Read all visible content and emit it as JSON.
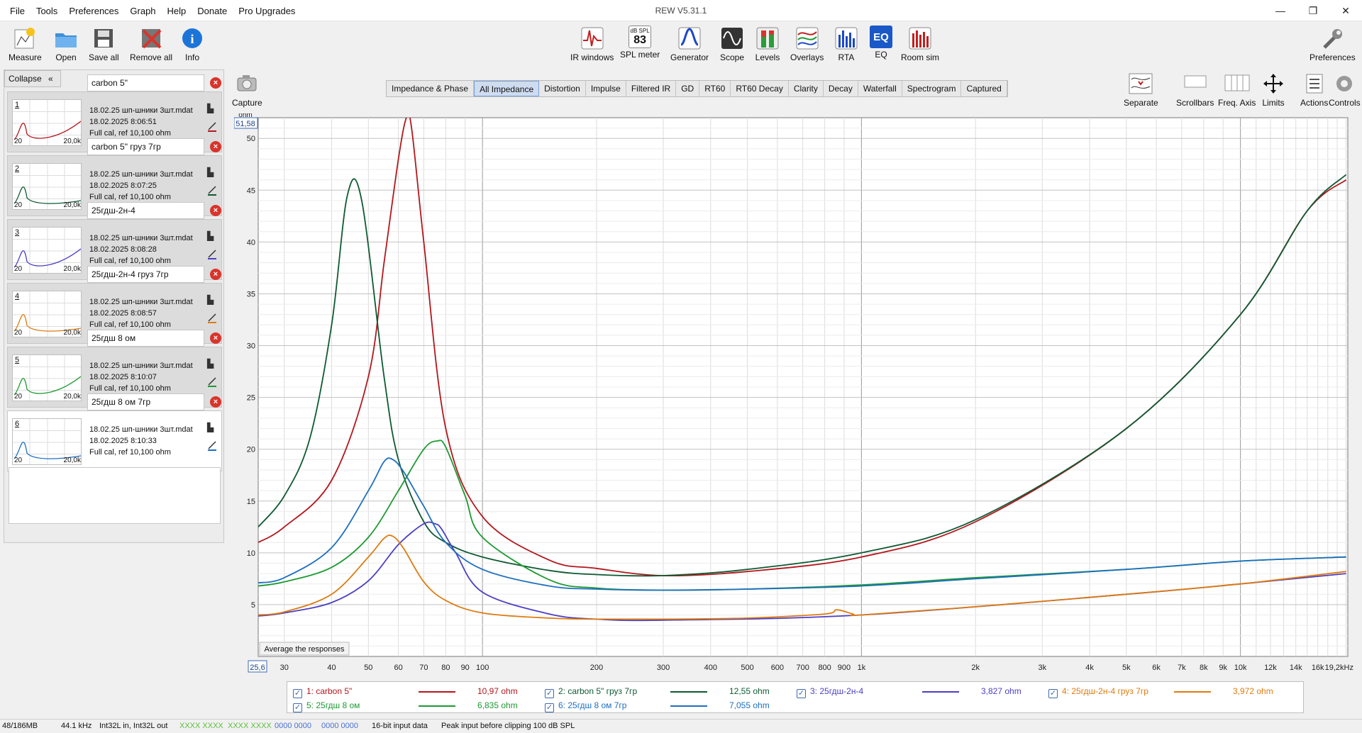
{
  "app": {
    "title": "REW V5.31.1",
    "menus": [
      "File",
      "Tools",
      "Preferences",
      "Graph",
      "Help",
      "Donate",
      "Pro Upgrades"
    ],
    "window_controls": [
      "—",
      "❐",
      "✕"
    ]
  },
  "toolbar": {
    "measure": "Measure",
    "open": "Open",
    "save_all": "Save all",
    "remove_all": "Remove all",
    "info": "Info",
    "ir_windows": "IR windows",
    "spl_meter": "SPL meter",
    "spl_badge": "dB SPL",
    "spl_value": "83",
    "generator": "Generator",
    "scope": "Scope",
    "levels": "Levels",
    "overlays": "Overlays",
    "rta": "RTA",
    "eq": "EQ",
    "eq_badge": "EQ",
    "room_sim": "Room sim",
    "preferences": "Preferences",
    "capture": "Capture",
    "separate": "Separate",
    "scrollbars": "Scrollbars",
    "freq_axis": "Freq. Axis",
    "limits": "Limits",
    "actions": "Actions",
    "controls": "Controls"
  },
  "panel": {
    "collapse": "Collapse",
    "collapse_icon": "«",
    "entries": [
      {
        "num": "1",
        "name": "carbon 5\"",
        "file": "18.02.25 шп-шники 3шт.mdat",
        "date": "18.02.2025 8:06:51",
        "cal": "Full cal, ref 10,100 ohm",
        "color": "#b3171d"
      },
      {
        "num": "2",
        "name": "carbon 5\" груз 7гр",
        "file": "18.02.25 шп-шники 3шт.mdat",
        "date": "18.02.2025 8:07:25",
        "cal": "Full cal, ref 10,100 ohm",
        "color": "#0e5a33"
      },
      {
        "num": "3",
        "name": "25гдш-2н-4",
        "file": "18.02.25 шп-шники 3шт.mdat",
        "date": "18.02.2025 8:08:28",
        "cal": "Full cal, ref 10,100 ohm",
        "color": "#4b3fc4"
      },
      {
        "num": "4",
        "name": "25гдш-2н-4 груз 7гр",
        "file": "18.02.25 шп-шники 3шт.mdat",
        "date": "18.02.2025 8:08:57",
        "cal": "Full cal, ref 10,100 ohm",
        "color": "#de7b10"
      },
      {
        "num": "5",
        "name": "25гдш 8 ом",
        "file": "18.02.25 шп-шники 3шт.mdat",
        "date": "18.02.2025 8:10:07",
        "cal": "Full cal, ref 10,100 ohm",
        "color": "#1d9a32"
      },
      {
        "num": "6",
        "name": "25гдш 8 ом 7гр",
        "file": "18.02.25 шп-шники 3шт.mdat",
        "date": "18.02.2025 8:10:33",
        "cal": "Full cal, ref 10,100 ohm",
        "color": "#1d6fc0"
      }
    ],
    "thumb_lo": "20",
    "thumb_hi": "20,0k"
  },
  "tabs": [
    "Impedance & Phase",
    "All Impedance",
    "Distortion",
    "Impulse",
    "Filtered IR",
    "GD",
    "RT60",
    "RT60 Decay",
    "Clarity",
    "Decay",
    "Waterfall",
    "Spectrogram",
    "Captured"
  ],
  "active_tab": "All Impedance",
  "graph": {
    "average_button": "Average the responses",
    "cursor_y": "51,58",
    "unit_label": "ohm",
    "cursor_x": "25,6"
  },
  "chart_data": {
    "type": "line",
    "title": "",
    "xlabel": "",
    "ylabel": "ohm",
    "x_scale": "log",
    "xlim": [
      25.6,
      19200
    ],
    "ylim": [
      0,
      52
    ],
    "grid": true,
    "x_tick_labels": [
      "30",
      "40",
      "50",
      "60",
      "70",
      "80",
      "90",
      "100",
      "200",
      "300",
      "400",
      "500",
      "600",
      "700",
      "800",
      "900",
      "1k",
      "2k",
      "3k",
      "4k",
      "5k",
      "6k",
      "7k",
      "8k",
      "9k",
      "10k",
      "12k",
      "14k",
      "16k",
      "19,2kHz"
    ],
    "x_tick_values": [
      30,
      40,
      50,
      60,
      70,
      80,
      90,
      100,
      200,
      300,
      400,
      500,
      600,
      700,
      800,
      900,
      1000,
      2000,
      3000,
      4000,
      5000,
      6000,
      7000,
      8000,
      9000,
      10000,
      12000,
      14000,
      16000,
      19200
    ],
    "y_tick_values": [
      5,
      10,
      15,
      20,
      25,
      30,
      35,
      40,
      45,
      50
    ],
    "y_tick_labels": [
      "5",
      "10",
      "15",
      "20",
      "25",
      "30",
      "35",
      "40",
      "45",
      "50"
    ],
    "series": [
      {
        "name": "1: carbon 5\"",
        "color": "#b3171d",
        "value_label": "10,97 ohm",
        "x": [
          25.6,
          30,
          40,
          50,
          55,
          60,
          63,
          65,
          70,
          80,
          100,
          150,
          200,
          300,
          500,
          1000,
          2000,
          5000,
          10000,
          15000,
          19000
        ],
        "y": [
          11,
          12.5,
          17,
          27,
          38,
          48,
          52,
          51,
          40,
          22,
          13.5,
          9.3,
          8.5,
          7.8,
          8.2,
          9.6,
          13,
          22,
          33,
          43,
          46
        ]
      },
      {
        "name": "2: carbon 5\" груз 7гр",
        "color": "#0e5a33",
        "value_label": "12,55 ohm",
        "x": [
          25.6,
          30,
          35,
          40,
          44,
          48,
          55,
          60,
          70,
          80,
          100,
          150,
          200,
          300,
          500,
          1000,
          2000,
          5000,
          10000,
          15000,
          19000
        ],
        "y": [
          12.5,
          15.5,
          21,
          32,
          44.5,
          44,
          27,
          19,
          13,
          11,
          9.6,
          8.3,
          7.9,
          7.8,
          8.4,
          10,
          13.2,
          22,
          33,
          43,
          46.5
        ]
      },
      {
        "name": "3: 25гдш-2н-4",
        "color": "#4b3fc4",
        "value_label": "3,827 ohm",
        "x": [
          25.6,
          30,
          40,
          50,
          60,
          70,
          75,
          78,
          85,
          100,
          150,
          200,
          300,
          1000,
          5000,
          10000,
          19000
        ],
        "y": [
          3.9,
          4.2,
          5.2,
          7.3,
          10.8,
          12.8,
          12.8,
          12.3,
          10,
          6.2,
          4.1,
          3.6,
          3.5,
          4,
          6,
          7,
          8
        ]
      },
      {
        "name": "4: 25гдш-2н-4 груз 7гр",
        "color": "#de7b10",
        "value_label": "3,972 ohm",
        "x": [
          25.6,
          30,
          40,
          50,
          55,
          58,
          62,
          70,
          80,
          100,
          150,
          200,
          300,
          500,
          800,
          860,
          950,
          1000,
          2000,
          5000,
          10000,
          19000
        ],
        "y": [
          4,
          4.3,
          6,
          9.6,
          11.4,
          11.6,
          10.4,
          7.2,
          5.4,
          4.2,
          3.7,
          3.6,
          3.6,
          3.7,
          4.1,
          4.5,
          4.1,
          4,
          4.8,
          6,
          7,
          8.2
        ]
      },
      {
        "name": "5: 25гдш 8 ом",
        "color": "#1d9a32",
        "value_label": "6,835 ohm",
        "x": [
          25.6,
          30,
          40,
          50,
          60,
          70,
          76,
          80,
          90,
          100,
          150,
          200,
          300,
          500,
          1000,
          2000,
          5000,
          10000,
          19000
        ],
        "y": [
          6.8,
          7.2,
          8.6,
          11.5,
          16,
          20,
          20.8,
          20.2,
          15.5,
          11.5,
          7.4,
          6.6,
          6.4,
          6.5,
          6.9,
          7.6,
          8.4,
          9.2,
          9.6
        ]
      },
      {
        "name": "6: 25гдш 8 ом 7гр",
        "color": "#1d6fc0",
        "value_label": "7,055 ohm",
        "x": [
          25.6,
          30,
          40,
          50,
          55,
          58,
          62,
          70,
          80,
          100,
          150,
          200,
          300,
          500,
          1000,
          2000,
          5000,
          10000,
          19000
        ],
        "y": [
          7.1,
          7.6,
          10.5,
          16,
          18.8,
          19,
          17.8,
          14.5,
          11,
          8.4,
          6.8,
          6.5,
          6.4,
          6.5,
          6.8,
          7.5,
          8.4,
          9.2,
          9.6
        ]
      }
    ]
  },
  "status": {
    "memory": "48/186MB",
    "rate": "44.1 kHz",
    "io": "Int32L in, Int32L out",
    "meter1": "XXXX XXXX",
    "meter2": "XXXX XXXX",
    "meter3": "0000 0000",
    "meter4": "0000 0000",
    "input": "16-bit input data",
    "peak": "Peak input before clipping 100 dB SPL"
  }
}
